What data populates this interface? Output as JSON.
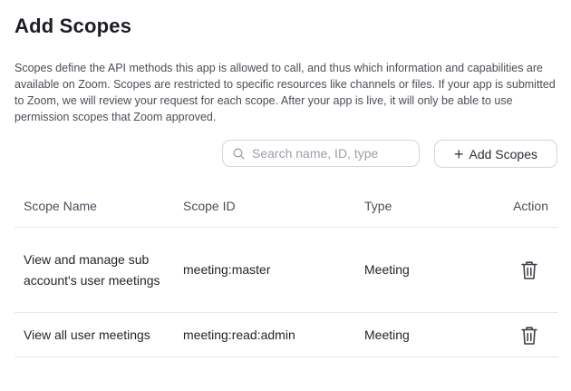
{
  "header": {
    "title": "Add Scopes",
    "description": "Scopes define the API methods this app is allowed to call, and thus which information and capabilities are available on Zoom. Scopes are restricted to specific resources like channels or files. If your app is submitted to Zoom, we will review your request for each scope. After your app is live, it will only be able to use permission scopes that Zoom approved."
  },
  "toolbar": {
    "search_placeholder": "Search name, ID, type",
    "search_value": "",
    "add_label": "Add Scopes"
  },
  "table": {
    "columns": {
      "name": "Scope Name",
      "id": "Scope ID",
      "type": "Type",
      "action": "Action"
    },
    "rows": [
      {
        "name": "View and manage sub account's user meetings",
        "id": "meeting:master",
        "type": "Meeting",
        "action_icon": "trash-icon"
      },
      {
        "name": "View all user meetings",
        "id": "meeting:read:admin",
        "type": "Meeting",
        "action_icon": "trash-icon"
      }
    ]
  }
}
